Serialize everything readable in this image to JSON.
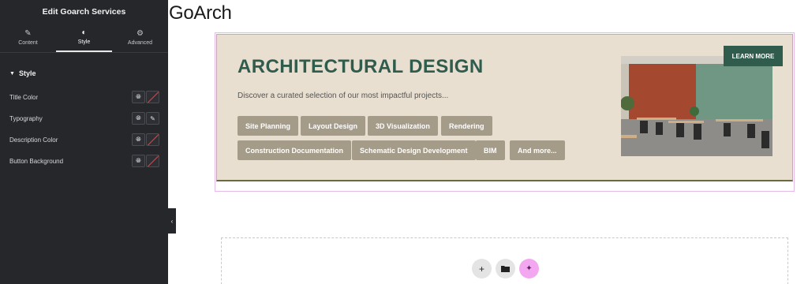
{
  "panel": {
    "title": "Edit Goarch Services",
    "tabs": [
      {
        "label": "Content",
        "icon": "pencil-icon"
      },
      {
        "label": "Style",
        "icon": "half-circle-icon"
      },
      {
        "label": "Advanced",
        "icon": "gear-icon"
      }
    ],
    "active_tab": "Style",
    "section_title": "Style",
    "controls": [
      {
        "label": "Title Color"
      },
      {
        "label": "Typography"
      },
      {
        "label": "Description Color"
      },
      {
        "label": "Button Background"
      }
    ]
  },
  "canvas": {
    "site_title": "GoArch",
    "banner": {
      "title": "ARCHITECTURAL DESIGN",
      "description": "Discover a curated selection of our most impactful projects...",
      "tags": [
        "Site Planning",
        "Layout Design",
        "3D Visualization",
        "Rendering",
        "Construction Documentation",
        "Schematic Design Development",
        "BIM",
        "And more..."
      ],
      "button": "LEARN MORE"
    }
  },
  "colors": {
    "panel_bg": "#26272b",
    "banner_bg": "#e8dfd0",
    "accent_green": "#2f5c4c",
    "tag_bg": "#a59b89",
    "ai_button": "#f2a7f0"
  }
}
